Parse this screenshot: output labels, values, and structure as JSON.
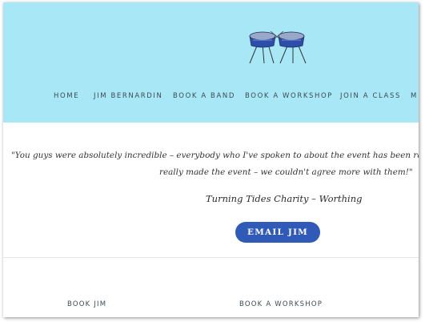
{
  "nav": {
    "items": [
      {
        "label": "HOME"
      },
      {
        "label": "JIM BERNARDIN"
      },
      {
        "label": "BOOK A BAND"
      },
      {
        "label": "BOOK A WORKSHOP"
      },
      {
        "label": "JOIN A CLASS"
      },
      {
        "label": "M"
      }
    ]
  },
  "testimonial": {
    "quote_line1": "\"You guys were absolutely incredible – everybody who I've spoken to about the event has been raving a",
    "quote_line2": "really made the event – we couldn't agree more with them!\"",
    "attribution": "Turning Tides Charity – Worthing"
  },
  "cta": {
    "label": "EMAIL JIM"
  },
  "footer": {
    "links": [
      {
        "label": "BOOK JIM"
      },
      {
        "label": "BOOK A WORKSHOP"
      }
    ]
  },
  "colors": {
    "header_bg": "#a8e8f6",
    "button_bg": "#2f5ab8",
    "drum_blue": "#2c4ea8"
  },
  "icons": {
    "logo": "steel-pan-drums-logo"
  }
}
